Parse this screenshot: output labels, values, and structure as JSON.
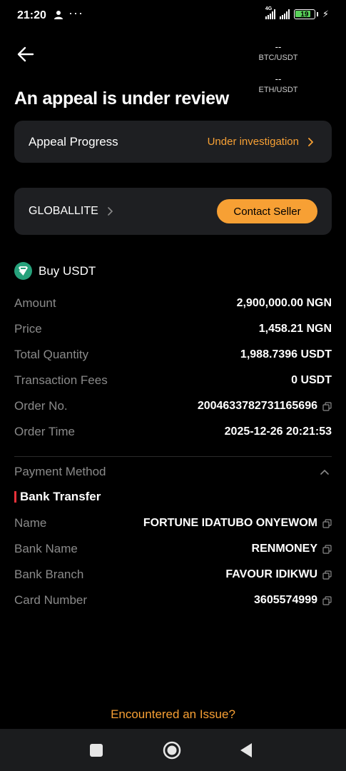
{
  "status_bar": {
    "time": "21:20",
    "dots": "···",
    "network": "4G",
    "battery": "19",
    "icons": [
      "person-icon",
      "signal-icon",
      "battery-icon",
      "charging-icon"
    ]
  },
  "header": {
    "back_icon": "arrow-left-icon",
    "tickers": [
      {
        "value": "--",
        "pair": "BTC/USDT"
      },
      {
        "value": "--",
        "pair": "ETH/USDT"
      }
    ],
    "title": "An appeal is under review"
  },
  "appeal": {
    "label": "Appeal Progress",
    "status": "Under investigation",
    "status_icon": "chevron-right-icon"
  },
  "seller": {
    "name": "GLOBALLITE",
    "contact_label": "Contact Seller"
  },
  "order": {
    "side_label": "Buy USDT",
    "coin_icon": "usdt-icon",
    "rows": [
      {
        "label": "Amount",
        "value": "2,900,000.00 NGN"
      },
      {
        "label": "Price",
        "value": "1,458.21 NGN"
      },
      {
        "label": "Total Quantity",
        "value": "1,988.7396 USDT"
      },
      {
        "label": "Transaction Fees",
        "value": "0 USDT"
      },
      {
        "label": "Order No.",
        "value": "2004633782731165696"
      },
      {
        "label": "Order Time",
        "value": "2025-12-26 20:21:53"
      }
    ]
  },
  "payment": {
    "label": "Payment Method",
    "method": "Bank Transfer",
    "rows": [
      {
        "label": "Name",
        "value": "FORTUNE IDATUBO ONYEWOM"
      },
      {
        "label": "Bank Name",
        "value": "RENMONEY"
      },
      {
        "label": "Bank Branch",
        "value": "FAVOUR IDIKWU"
      },
      {
        "label": "Card Number",
        "value": "3605574999"
      }
    ]
  },
  "footer": {
    "issue_label": "Encountered an Issue?"
  },
  "colors": {
    "accent": "#f7a034",
    "card_bg": "#1e1f22",
    "muted": "#8a8a8a",
    "usdt": "#26a17b",
    "marker": "#e9323a"
  }
}
